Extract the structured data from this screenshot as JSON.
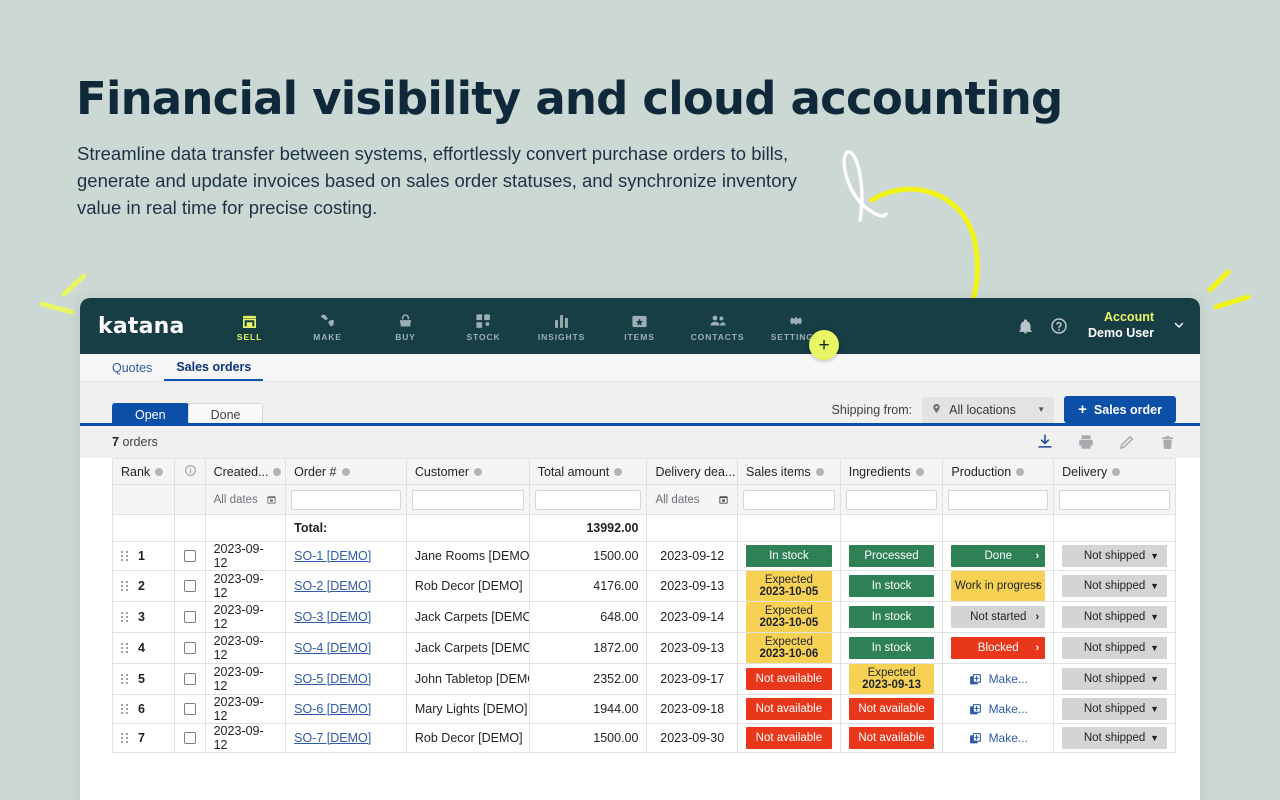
{
  "marketing": {
    "headline": "Financial visibility and cloud accounting",
    "subcopy": "Streamline data transfer between systems, effortlessly convert purchase orders to bills, generate and update invoices based on sales order statuses, and synchronize inventory value in real time for precise costing.",
    "accent_yellow": "#f2f318",
    "background": "#ccd8d4",
    "headline_color": "#10293a"
  },
  "app": {
    "brand": "katana",
    "nav": [
      {
        "label": "SELL",
        "icon": "store-icon",
        "active": true
      },
      {
        "label": "MAKE",
        "icon": "tools-icon",
        "active": false
      },
      {
        "label": "BUY",
        "icon": "basket-icon",
        "active": false
      },
      {
        "label": "STOCK",
        "icon": "boxes-icon",
        "active": false
      },
      {
        "label": "INSIGHTS",
        "icon": "bar-chart-icon",
        "active": false
      },
      {
        "label": "ITEMS",
        "icon": "item-tag-icon",
        "active": false
      },
      {
        "label": "CONTACTS",
        "icon": "people-icon",
        "active": false
      },
      {
        "label": "SETTINGS",
        "icon": "gear-icon",
        "active": false
      }
    ],
    "add_button": "+",
    "notifications_icon": "bell-icon",
    "help_icon": "help-circle-icon",
    "account_label": "Account",
    "account_user": "Demo User",
    "account_caret": "⌄",
    "subtabs": [
      {
        "label": "Quotes",
        "active": false
      },
      {
        "label": "Sales orders",
        "active": true
      }
    ],
    "status_tabs": [
      {
        "label": "Open",
        "active": true
      },
      {
        "label": "Done",
        "active": false
      }
    ],
    "shipping_from_label": "Shipping from:",
    "location_value": "All locations",
    "location_icon": "pin-icon",
    "sales_order_button": "Sales order",
    "orders_count": "7",
    "orders_word": "orders",
    "tool_icons": [
      {
        "name": "export-download-icon",
        "enabled": true
      },
      {
        "name": "print-icon",
        "enabled": false
      },
      {
        "name": "edit-pencil-icon",
        "enabled": false
      },
      {
        "name": "delete-trash-icon",
        "enabled": false
      }
    ]
  },
  "table": {
    "columns": [
      {
        "label": "Rank",
        "info": true
      },
      {
        "label": "",
        "info": false
      },
      {
        "label": "Created...",
        "info": true
      },
      {
        "label": "Order #",
        "info": true
      },
      {
        "label": "Customer",
        "info": true
      },
      {
        "label": "Total amount",
        "info": true
      },
      {
        "label": "Delivery dea...",
        "info": true
      },
      {
        "label": "Sales items",
        "info": true
      },
      {
        "label": "Ingredients",
        "info": true
      },
      {
        "label": "Production",
        "info": true
      },
      {
        "label": "Delivery",
        "info": true
      }
    ],
    "filters": {
      "created_placeholder": "All dates",
      "deadline_placeholder": "All dates",
      "calendar_icon": "calendar-icon"
    },
    "total_label": "Total:",
    "total_amount": "13992.00",
    "rows": [
      {
        "rank": "1",
        "created": "2023-09-12",
        "order": "SO-1 [DEMO]",
        "customer": "Jane Rooms [DEMO]",
        "amount": "1500.00",
        "deadline": "2023-09-12",
        "sales_items": {
          "type": "green",
          "text": "In stock"
        },
        "ingredients": {
          "type": "green",
          "text": "Processed"
        },
        "production": {
          "type": "green",
          "text": "Done",
          "chevron": "›"
        },
        "delivery": {
          "type": "grey",
          "text": "Not shipped"
        }
      },
      {
        "rank": "2",
        "created": "2023-09-12",
        "order": "SO-2 [DEMO]",
        "customer": "Rob Decor [DEMO]",
        "amount": "4176.00",
        "deadline": "2023-09-13",
        "sales_items": {
          "type": "yellow",
          "text": "Expected",
          "text2": "2023-10-05"
        },
        "ingredients": {
          "type": "green",
          "text": "In stock"
        },
        "production": {
          "type": "yellow",
          "text": "Work in progress",
          "chevron": "›"
        },
        "delivery": {
          "type": "grey",
          "text": "Not shipped"
        }
      },
      {
        "rank": "3",
        "created": "2023-09-12",
        "order": "SO-3 [DEMO]",
        "customer": "Jack Carpets [DEMO]",
        "amount": "648.00",
        "deadline": "2023-09-14",
        "sales_items": {
          "type": "yellow",
          "text": "Expected",
          "text2": "2023-10-05"
        },
        "ingredients": {
          "type": "green",
          "text": "In stock"
        },
        "production": {
          "type": "grey",
          "text": "Not started",
          "chevron": "›"
        },
        "delivery": {
          "type": "grey",
          "text": "Not shipped"
        }
      },
      {
        "rank": "4",
        "created": "2023-09-12",
        "order": "SO-4 [DEMO]",
        "customer": "Jack Carpets [DEMO]",
        "amount": "1872.00",
        "deadline": "2023-09-13",
        "sales_items": {
          "type": "yellow",
          "text": "Expected",
          "text2": "2023-10-06"
        },
        "ingredients": {
          "type": "green",
          "text": "In stock"
        },
        "production": {
          "type": "red",
          "text": "Blocked",
          "chevron": "›"
        },
        "delivery": {
          "type": "grey",
          "text": "Not shipped"
        }
      },
      {
        "rank": "5",
        "created": "2023-09-12",
        "order": "SO-5 [DEMO]",
        "customer": "John Tabletop [DEMO]",
        "amount": "2352.00",
        "deadline": "2023-09-17",
        "sales_items": {
          "type": "red",
          "text": "Not available"
        },
        "ingredients": {
          "type": "yellow",
          "text": "Expected",
          "text2": "2023-09-13"
        },
        "production": {
          "type": "make",
          "text": "Make...",
          "icon": "make-copy-icon"
        },
        "delivery": {
          "type": "grey",
          "text": "Not shipped"
        }
      },
      {
        "rank": "6",
        "created": "2023-09-12",
        "order": "SO-6 [DEMO]",
        "customer": "Mary Lights [DEMO]",
        "amount": "1944.00",
        "deadline": "2023-09-18",
        "sales_items": {
          "type": "red",
          "text": "Not available"
        },
        "ingredients": {
          "type": "red",
          "text": "Not available"
        },
        "production": {
          "type": "make",
          "text": "Make...",
          "icon": "make-copy-icon"
        },
        "delivery": {
          "type": "grey",
          "text": "Not shipped"
        }
      },
      {
        "rank": "7",
        "created": "2023-09-12",
        "order": "SO-7 [DEMO]",
        "customer": "Rob Decor [DEMO]",
        "amount": "1500.00",
        "deadline": "2023-09-30",
        "sales_items": {
          "type": "red",
          "text": "Not available"
        },
        "ingredients": {
          "type": "red",
          "text": "Not available"
        },
        "production": {
          "type": "make",
          "text": "Make...",
          "icon": "make-copy-icon"
        },
        "delivery": {
          "type": "grey",
          "text": "Not shipped"
        }
      }
    ]
  }
}
